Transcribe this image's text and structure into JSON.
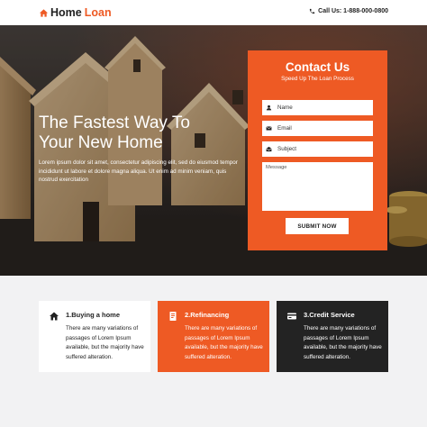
{
  "header": {
    "logo_word1": "Home",
    "logo_word2": "Loan",
    "logo_icon": "home-icon",
    "call": "Call Us: 1-888-000-0800",
    "call_icon": "phone-icon"
  },
  "hero": {
    "title_line1": "The Fastest Way To",
    "title_line2": "Your New Home",
    "text": "Lorem ipsum dolor sit amet, consectetur adipiscing elit, sed do eiusmod tempor incididunt ut labore et dolore magna aliqua. Ut enim ad minim veniam, quis nostrud exercitation"
  },
  "contact": {
    "title": "Contact Us",
    "subtitle": "Speed Up The Loan Process",
    "name_label": "Name",
    "email_label": "Email",
    "subject_label": "Subject",
    "message_label": "Message",
    "submit_label": "SUBMIT NOW"
  },
  "features": [
    {
      "title": "1.Buying a home",
      "text": "There are many variations of passages of Lorem Ipsum available, but the majority have suffered alteration.",
      "icon": "home-icon"
    },
    {
      "title": "2.Refinancing",
      "text": "There are many variations of passages of Lorem Ipsum available, but the majority have suffered alteration.",
      "icon": "document-icon"
    },
    {
      "title": "3.Credit Service",
      "text": "There are many variations of passages of Lorem Ipsum available, but the majority have suffered alteration.",
      "icon": "credit-card-icon"
    }
  ],
  "colors": {
    "accent": "#ee5a24",
    "dark": "#232323",
    "section_bg": "#f2f2f3"
  }
}
